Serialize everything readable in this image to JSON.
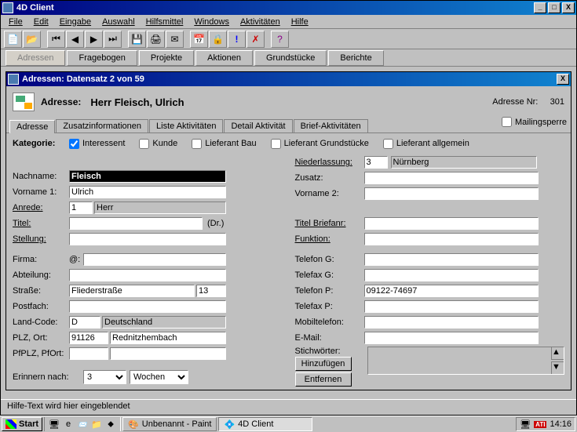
{
  "app_title": "4D Client",
  "menu": [
    "File",
    "Edit",
    "Eingabe",
    "Auswahl",
    "Hilfsmittel",
    "Windows",
    "Aktivitäten",
    "Hilfe"
  ],
  "primary_tabs": [
    "Adressen",
    "Fragebogen",
    "Projekte",
    "Aktionen",
    "Grundstücke",
    "Berichte"
  ],
  "subwin_title": "Adressen: Datensatz 2 von 59",
  "header_label": "Adresse:",
  "header_name": "Herr Fleisch, Ulrich",
  "adresse_nr_label": "Adresse Nr:",
  "adresse_nr": "301",
  "inner_tabs": [
    "Adresse",
    "Zusatzinformationen",
    "Liste Aktivitäten",
    "Detail Aktivität",
    "Brief-Aktivitäten"
  ],
  "mailingsperre_label": "Mailingsperre",
  "kategorie_label": "Kategorie:",
  "checks": {
    "interessent": "Interessent",
    "kunde": "Kunde",
    "lief_bau": "Lieferant Bau",
    "lief_grund": "Lieferant Grundstücke",
    "lief_allg": "Lieferant allgemein"
  },
  "left": {
    "nachname_l": "Nachname:",
    "nachname": "Fleisch",
    "vorname1_l": "Vorname 1:",
    "vorname1": "Ulrich",
    "anrede_l": "Anrede:",
    "anrede_code": "1",
    "anrede_txt": "Herr",
    "titel_l": "Titel:",
    "titel": "",
    "titel_suffix": "(Dr.)",
    "stellung_l": "Stellung:",
    "stellung": "",
    "firma_l": "Firma:",
    "firma_at": "@:",
    "firma": "",
    "abteilung_l": "Abteilung:",
    "abteilung": "",
    "strasse_l": "Straße:",
    "strasse": "Fliederstraße",
    "hausnr": "13",
    "postfach_l": "Postfach:",
    "postfach": "",
    "landcode_l": "Land-Code:",
    "landcode": "D",
    "land": "Deutschland",
    "plzort_l": "PLZ, Ort:",
    "plz": "91126",
    "ort": "Rednitzhembach",
    "pfplz_l": "PfPLZ, PfOrt:",
    "pfplz": "",
    "pfort": "",
    "erinnern_l": "Erinnern nach:",
    "erinnern_val": "3",
    "erinnern_unit": "Wochen"
  },
  "right": {
    "niederlassung_l": "Niederlassung:",
    "nieder_code": "3",
    "nieder_txt": "Nürnberg",
    "zusatz_l": "Zusatz:",
    "zusatz": "",
    "vorname2_l": "Vorname 2:",
    "vorname2": "",
    "titelbrief_l": "Titel Briefanr:",
    "titelbrief": "",
    "funktion_l": "Funktion:",
    "funktion": "",
    "telefong_l": "Telefon G:",
    "telefong": "",
    "telefaxg_l": "Telefax G:",
    "telefaxg": "",
    "telefonp_l": "Telefon P:",
    "telefonp": "09122-74697",
    "telefaxp_l": "Telefax P:",
    "telefaxp": "",
    "mobil_l": "Mobiltelefon:",
    "mobil": "",
    "email_l": "E-Mail:",
    "email": "",
    "stich_l": "Stichwörter:",
    "hinzu": "Hinzufügen",
    "entf": "Entfernen"
  },
  "status_text": "Hilfe-Text wird hier eingeblendet",
  "taskbar": {
    "start": "Start",
    "task1": "Unbenannt - Paint",
    "task2": "4D Client",
    "time": "14:16",
    "ati": "ATI"
  }
}
